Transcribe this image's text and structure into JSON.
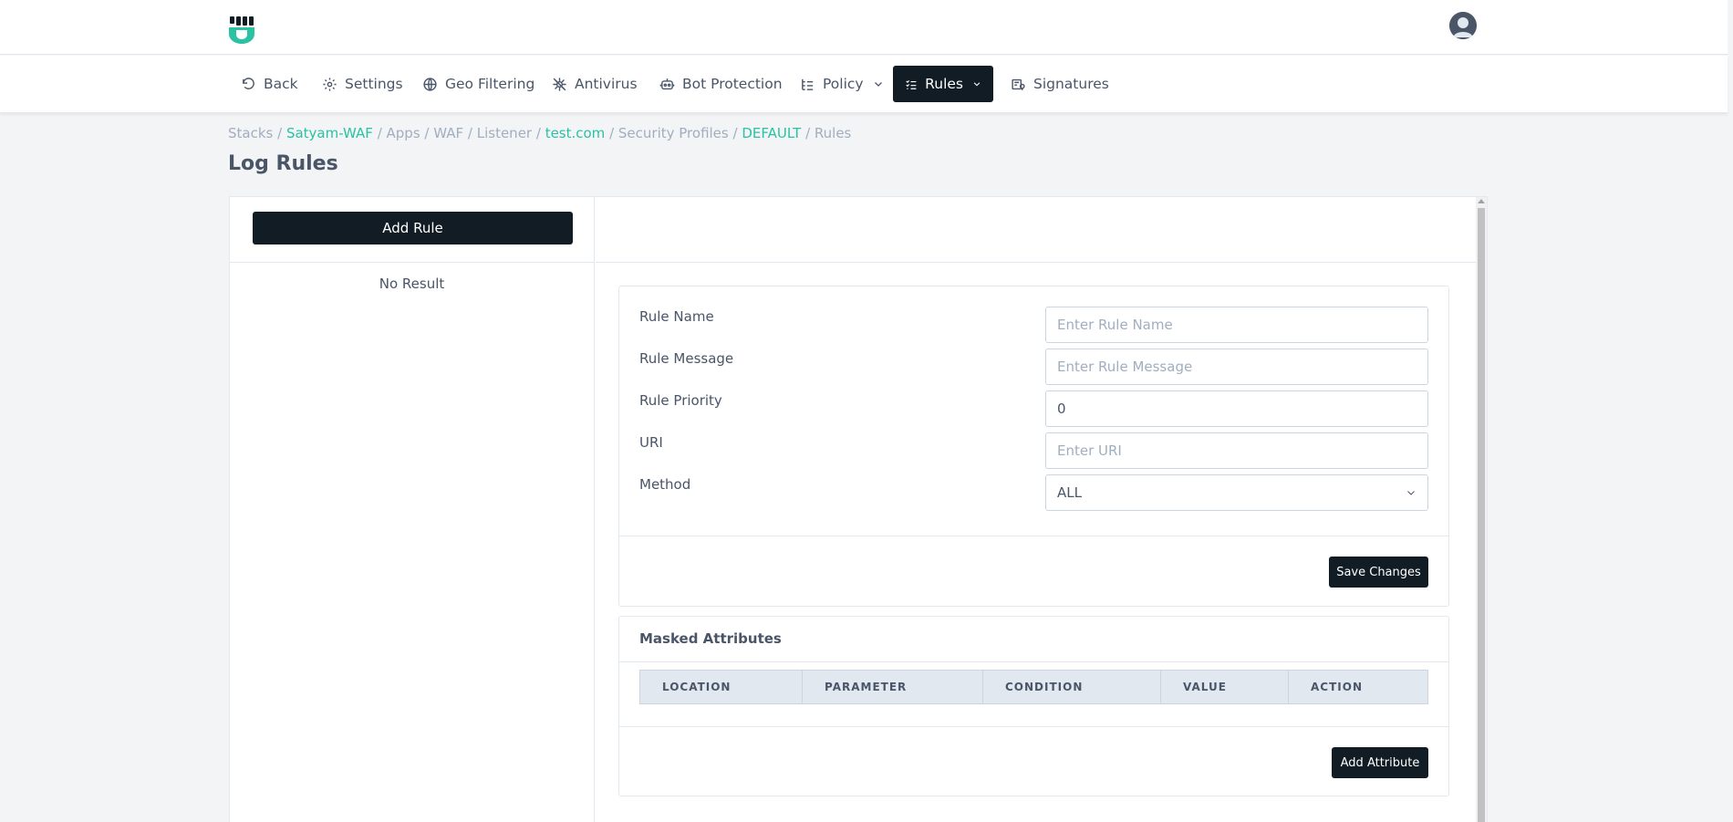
{
  "nav": {
    "back": "Back",
    "settings": "Settings",
    "geo_filtering": "Geo Filtering",
    "antivirus": "Antivirus",
    "bot_protection": "Bot Protection",
    "policy": "Policy",
    "rules": "Rules",
    "signatures": "Signatures"
  },
  "breadcrumb": {
    "stacks": "Stacks",
    "stack_name": "Satyam-WAF",
    "apps": "Apps",
    "waf": "WAF",
    "listener": "Listener",
    "domain": "test.com",
    "security_profiles": "Security Profiles",
    "profile": "DEFAULT",
    "rules": "Rules",
    "sep": " / "
  },
  "page": {
    "title": "Log Rules"
  },
  "left": {
    "add_rule": "Add Rule",
    "no_result": "No Result"
  },
  "form": {
    "rule_name_label": "Rule Name",
    "rule_name_placeholder": "Enter Rule Name",
    "rule_message_label": "Rule Message",
    "rule_message_placeholder": "Enter Rule Message",
    "rule_priority_label": "Rule Priority",
    "rule_priority_value": "0",
    "uri_label": "URI",
    "uri_placeholder": "Enter URI",
    "method_label": "Method",
    "method_value": "ALL",
    "save": "Save Changes"
  },
  "masked": {
    "title": "Masked Attributes",
    "columns": [
      "LOCATION",
      "PARAMETER",
      "CONDITION",
      "VALUE",
      "ACTION"
    ],
    "add_attribute": "Add Attribute"
  },
  "colors": {
    "primary_dark": "#111c24",
    "accent": "#2bc1a3",
    "logo_green": "#2bc1a3"
  },
  "icons": {
    "back": "undo-icon",
    "settings": "gear-icon",
    "geo": "globe-icon",
    "antivirus": "virus-icon",
    "bot": "robot-icon",
    "policy": "list-tree-icon",
    "rules": "checklist-icon",
    "signatures": "signature-icon"
  }
}
